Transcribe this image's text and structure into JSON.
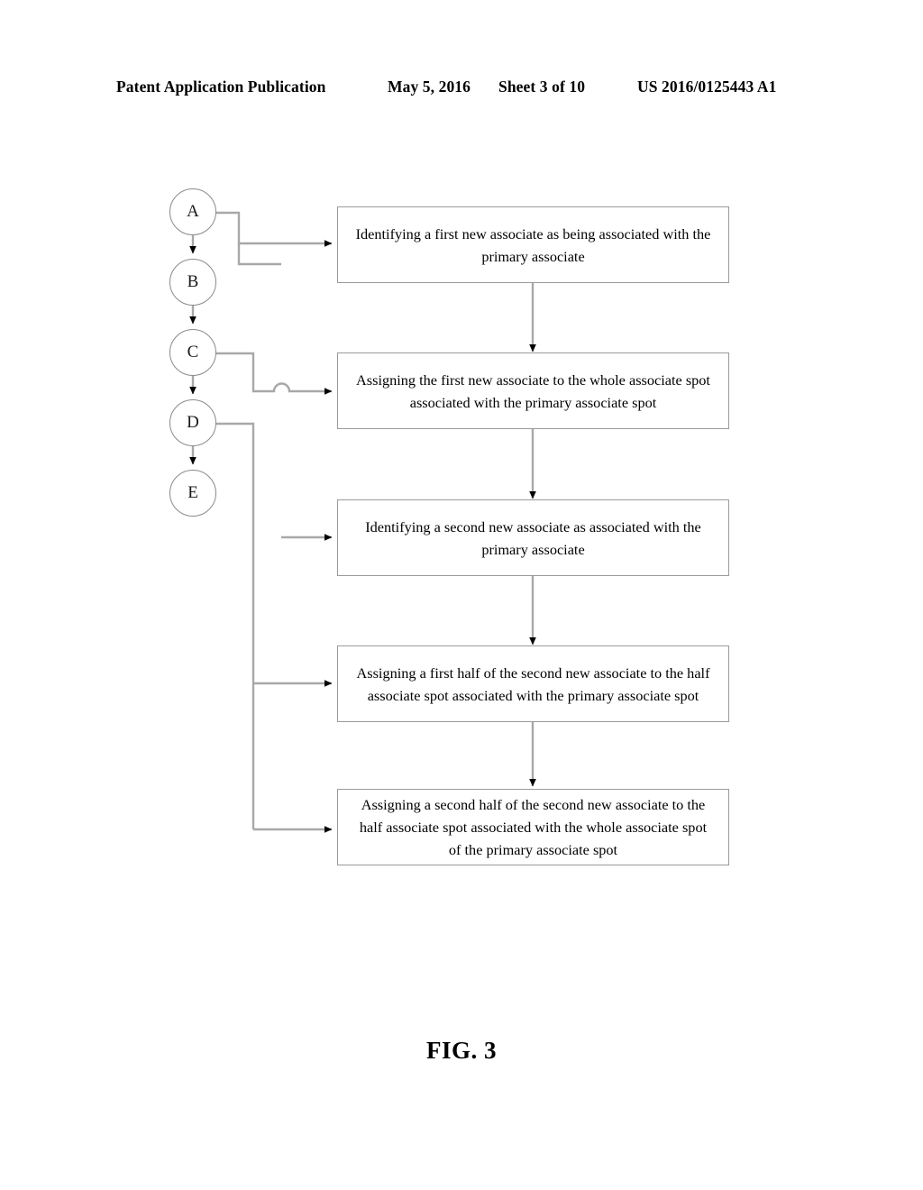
{
  "header": {
    "publication": "Patent Application Publication",
    "date": "May 5, 2016",
    "sheet": "Sheet 3 of 10",
    "patent_number": "US 2016/0125443 A1"
  },
  "figure": {
    "caption": "FIG. 3",
    "stroke_color": "#8a8a8a",
    "arrow_color": "#000000",
    "box_border_color": "#9a9a9a",
    "background_color": "#ffffff",
    "nodes": [
      {
        "id": "A",
        "label": "A"
      },
      {
        "id": "B",
        "label": "B"
      },
      {
        "id": "C",
        "label": "C"
      },
      {
        "id": "D",
        "label": "D"
      },
      {
        "id": "E",
        "label": "E"
      }
    ],
    "boxes": [
      {
        "id": "box-1",
        "text": "Identifying a first new associate as being associated with the primary associate"
      },
      {
        "id": "box-2",
        "text": "Assigning the first new associate to the whole associate spot associated with the primary associate spot"
      },
      {
        "id": "box-3",
        "text": "Identifying a second new associate as associated with the primary associate"
      },
      {
        "id": "box-4",
        "text": "Assigning a first half of the second new associate to the half associate spot associated with the primary associate spot"
      },
      {
        "id": "box-5",
        "text": "Assigning a second half of the second new associate to the half associate spot associated with the whole associate spot of the primary associate spot"
      }
    ]
  }
}
